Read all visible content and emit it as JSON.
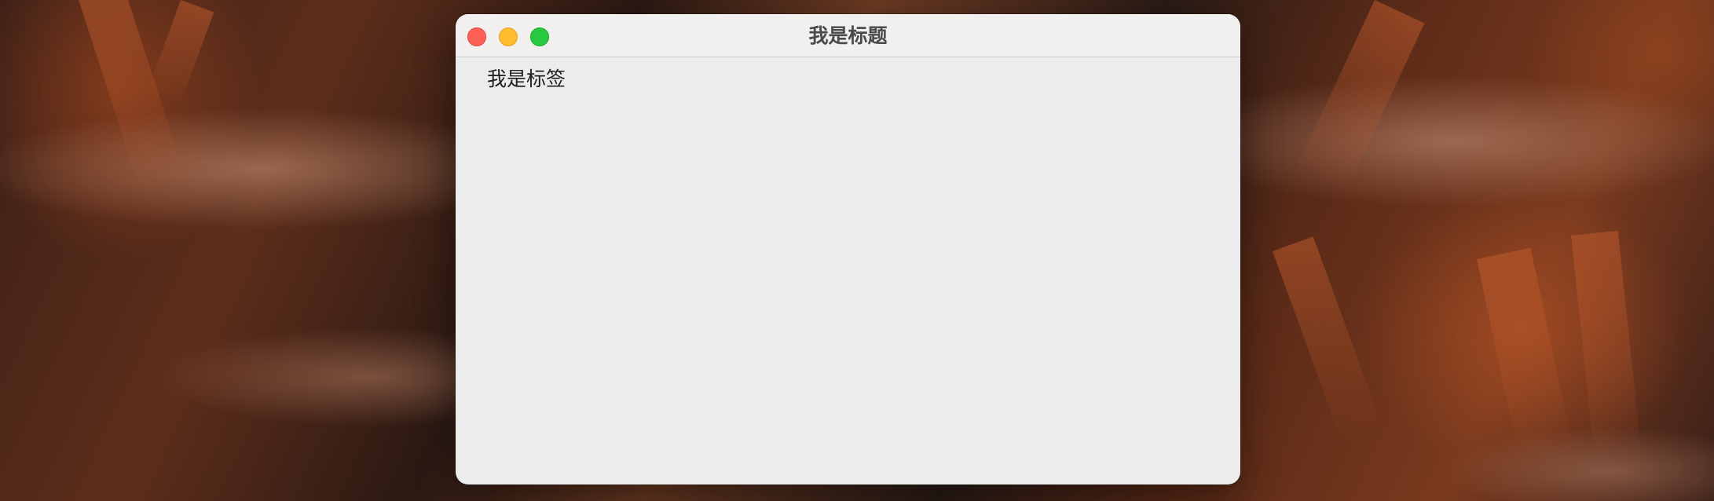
{
  "window": {
    "title": "我是标题",
    "label": "我是标签"
  },
  "traffic_lights": {
    "close_color": "#fe5f57",
    "minimize_color": "#febc2e",
    "maximize_color": "#28c840"
  }
}
